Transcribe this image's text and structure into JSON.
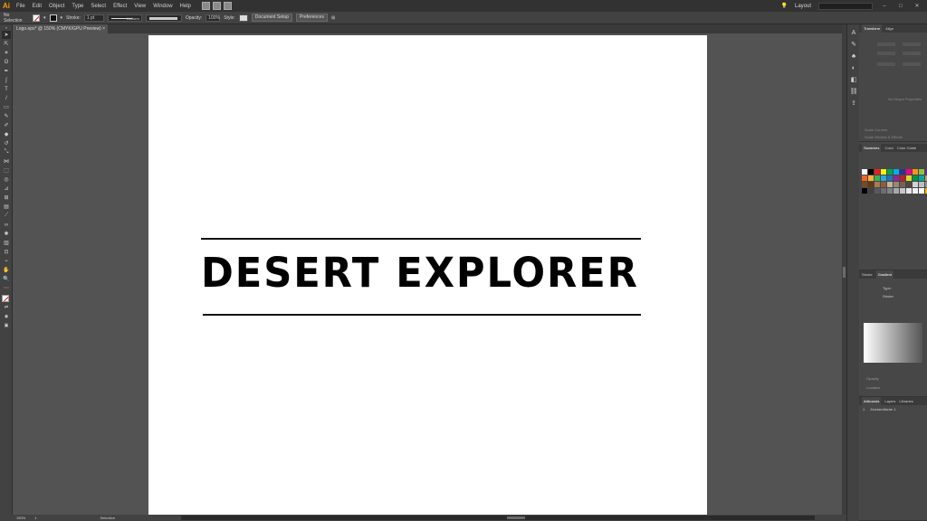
{
  "app": {
    "logo": "Ai"
  },
  "menu": [
    "File",
    "Edit",
    "Object",
    "Type",
    "Select",
    "Effect",
    "View",
    "Window",
    "Help"
  ],
  "menubar_right": {
    "workspace": "Layout"
  },
  "control_bar": {
    "selection": "No Selection",
    "stroke_label": "Stroke:",
    "stroke_value": "1 pt",
    "stroke_style": "Uniform",
    "opacity_label": "Opacity:",
    "opacity_value": "100%",
    "style_label": "Style:",
    "document_setup": "Document Setup",
    "preferences": "Preferences"
  },
  "document_tab": {
    "title": "Logo.eps* @ 150% (CMYK/GPU Preview)",
    "close": "×"
  },
  "artwork": {
    "text": "DESERT EXPLORER"
  },
  "status_bar": {
    "zoom": "150%",
    "artboard": "1",
    "tool": "Selection"
  },
  "panels": {
    "transform_tabs": [
      "Transform",
      "Align"
    ],
    "no_shape": "No Shape Properties",
    "scale_corners": "Scale Corners",
    "scale_strokes": "Scale Strokes & Effects",
    "swatch_tabs": [
      "Swatches",
      "Color",
      "Color Guide"
    ],
    "gradient_tabs": [
      "Stroke",
      "Gradient"
    ],
    "type_label": "Type:",
    "stroke_label": "Stroke:",
    "opacity_label": "Opacity",
    "location_label": "Location",
    "artboard_tabs": [
      "Artboards",
      "Layers",
      "Libraries"
    ],
    "artboard_item_number": "1",
    "artboard_item_name": "Zeichenfläche 1"
  },
  "colors": {
    "swatches": [
      "#ffffff",
      "#000000",
      "#ed1c24",
      "#fff200",
      "#00a651",
      "#00aeef",
      "#2e3192",
      "#ec008c",
      "#f7941d",
      "#8dc63f",
      "#662d91",
      "#f26522",
      "#fbb040",
      "#39b54a",
      "#27aae1",
      "#1c75bc",
      "#92278f",
      "#be1e2d",
      "#d7df23",
      "#009444",
      "#00a79d",
      "#c49a6c",
      "#754c29",
      "#603913",
      "#a67c52",
      "#8b5e3c",
      "#c2b59b",
      "#998675",
      "#736357",
      "#534741",
      "#d1d3d4",
      "#bcbec0",
      "#939598",
      "#000000",
      "#414042",
      "#58595b",
      "#6d6e71",
      "#808285",
      "#a7a9ac",
      "#c7c8ca",
      "#e6e7e8",
      "#f1f2f2",
      "#ffffff",
      "#fdb913"
    ]
  }
}
